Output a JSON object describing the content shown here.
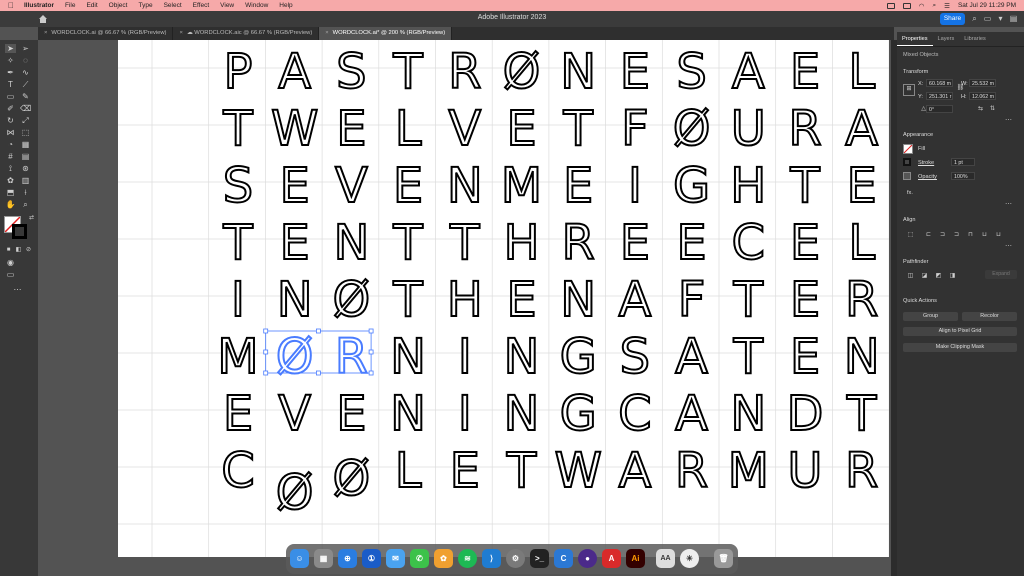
{
  "menubar": {
    "app_name": "Illustrator",
    "items": [
      "File",
      "Edit",
      "Object",
      "Type",
      "Select",
      "Effect",
      "View",
      "Window",
      "Help"
    ],
    "datetime": "Sat Jul 29  11:29 PM"
  },
  "titlebar": {
    "title": "Adobe Illustrator 2023",
    "share_label": "Share"
  },
  "tabs": [
    {
      "label": "WORDCLOCK.ai @ 66.67 % (RGB/Preview)",
      "active": false
    },
    {
      "label": "WORDCLOCK.aic @ 66.67 % (RGB/Preview)",
      "active": false
    },
    {
      "label": "WORDCLOCK.ai* @ 200 % (RGB/Preview)",
      "active": true
    }
  ],
  "panel": {
    "tabs": [
      "Properties",
      "Layers",
      "Libraries"
    ],
    "selection_label": "Mixed Objects",
    "transform": {
      "heading": "Transform",
      "x_label": "X:",
      "x_value": "60.168 m",
      "y_label": "Y:",
      "y_value": "251.301 r",
      "w_label": "W:",
      "w_value": "25.532 m",
      "h_label": "H:",
      "h_value": "12.062 m",
      "angle_value": "0°"
    },
    "appearance": {
      "heading": "Appearance",
      "fill_label": "Fill",
      "stroke_label": "Stroke",
      "stroke_value": "1 pt",
      "opacity_label": "Opacity",
      "opacity_value": "100%",
      "fx_label": "fx."
    },
    "align_heading": "Align",
    "pathfinder_heading": "Pathfinder",
    "expand_label": "Expand",
    "quick_actions": {
      "heading": "Quick Actions",
      "group_label": "Group",
      "recolor_label": "Recolor",
      "align_pixel_label": "Align to Pixel Grid",
      "clipping_mask_label": "Make Clipping Mask"
    }
  },
  "grid_rows": [
    "PASTRØNESAEL",
    "TWELVETFØURA",
    "SEVENMEIGHTE",
    "TENTTHREECEL",
    "INØTHENAFTER",
    "MØRNINGSATEN",
    "EVENINGCANDT",
    "CØØLETWARMUR"
  ],
  "selected_letters": [
    "Ø",
    "R"
  ],
  "colors": {
    "menubar": "#f6a9a9",
    "selection": "#4a7cff",
    "share_button": "#1473e6",
    "artboard": "#ffffff"
  },
  "dock_icons": [
    "finder-icon",
    "launchpad-icon",
    "safari-icon",
    "1password-icon",
    "mail-icon",
    "messages-icon",
    "photos-icon",
    "spotify-icon",
    "vscode-icon",
    "system-settings-icon",
    "terminal-icon",
    "c-app-icon",
    "dark-app-icon",
    "acrobat-icon",
    "illustrator-icon",
    "font-book-icon",
    "compass-icon",
    "trash-icon"
  ],
  "dock_labels": {
    "illustrator": "Ai",
    "font_book": "AA",
    "c_app": "C"
  }
}
